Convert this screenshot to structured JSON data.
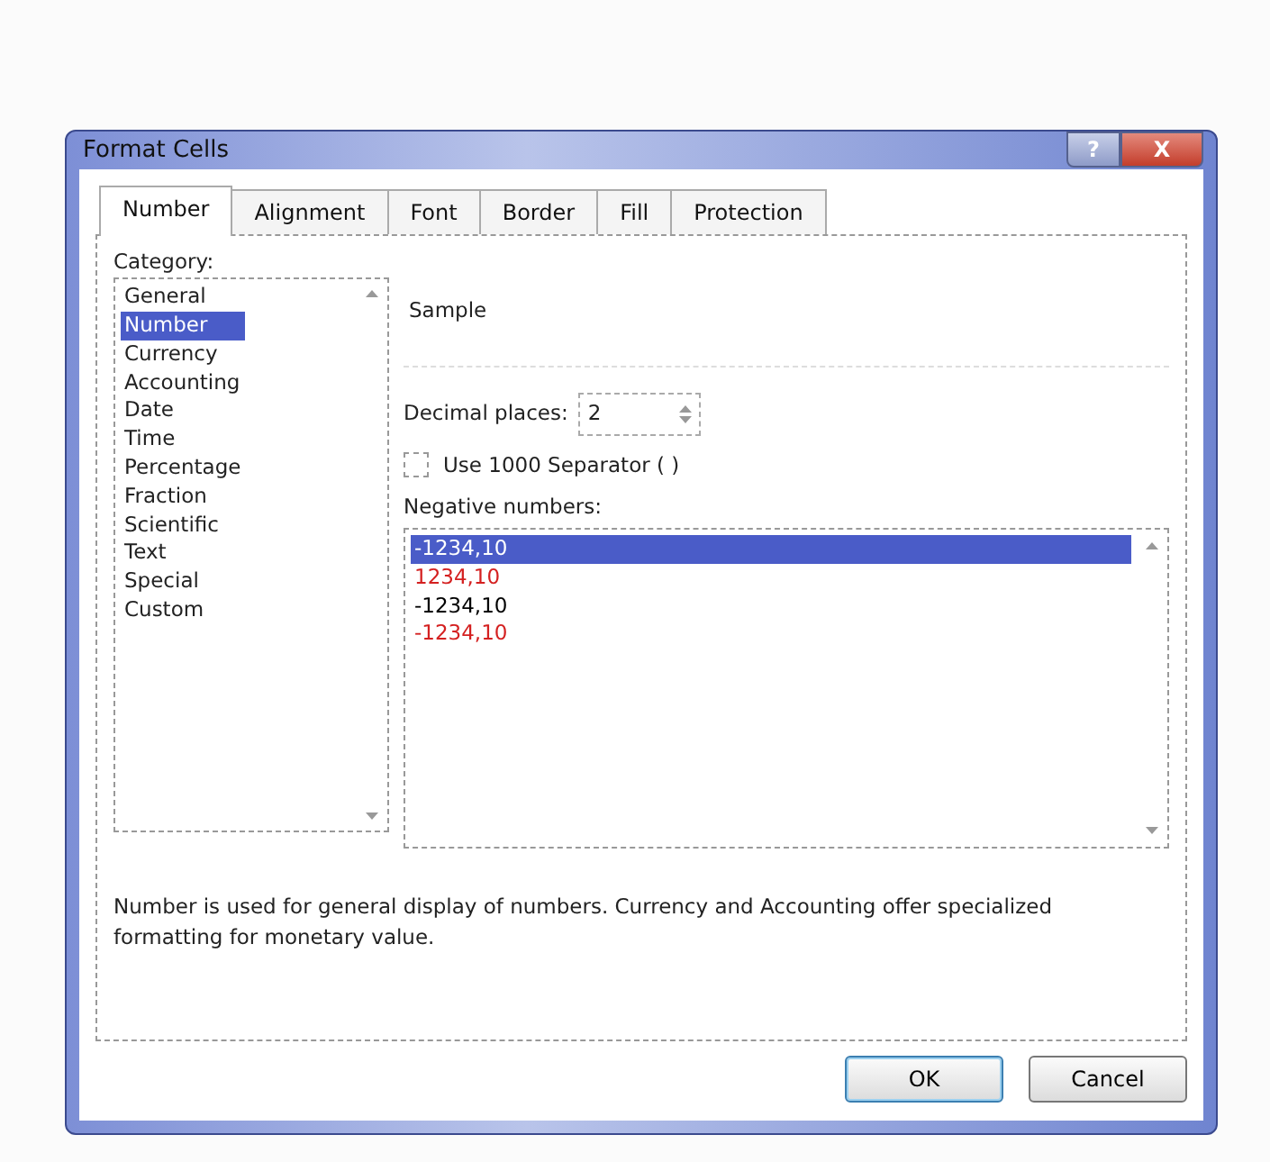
{
  "window": {
    "title": "Format Cells",
    "controls": [
      "?",
      "X"
    ]
  },
  "tabs": [
    {
      "label": "Number",
      "selected": true
    },
    {
      "label": "Alignment",
      "selected": false
    },
    {
      "label": "Font",
      "selected": false
    },
    {
      "label": "Border",
      "selected": false
    },
    {
      "label": "Fill",
      "selected": false
    },
    {
      "label": "Protection",
      "selected": false
    }
  ],
  "category": {
    "label": "Category:",
    "items": [
      {
        "label": "General",
        "selected": false
      },
      {
        "label": "Number",
        "selected": true
      },
      {
        "label": "Currency",
        "selected": false
      },
      {
        "label": "Accounting",
        "selected": false
      },
      {
        "label": "Date",
        "selected": false
      },
      {
        "label": "Time",
        "selected": false
      },
      {
        "label": "Percentage",
        "selected": false
      },
      {
        "label": "Fraction",
        "selected": false
      },
      {
        "label": "Scientific",
        "selected": false
      },
      {
        "label": "Text",
        "selected": false
      },
      {
        "label": "Special",
        "selected": false
      },
      {
        "label": "Custom",
        "selected": false
      }
    ]
  },
  "sample": {
    "label": "Sample"
  },
  "decimal_places": {
    "label": "Decimal places:",
    "value": "2"
  },
  "separator": {
    "label": "Use 1000 Separator ( )",
    "checked": false
  },
  "negative_numbers": {
    "label": "Negative numbers:",
    "items": [
      {
        "label": "-1234,10",
        "selected": true
      },
      {
        "label": "1234,10",
        "selected": false,
        "color": "#d42020"
      },
      {
        "label": "-1234,10",
        "selected": false,
        "color": "#000000"
      },
      {
        "label": "-1234,10",
        "selected": false,
        "color": "#d42020"
      }
    ]
  },
  "description": "Number is used for general display of numbers.  Currency and Accounting offer specialized formatting for monetary value.",
  "buttons": [
    {
      "label": "OK",
      "default": true
    },
    {
      "label": "Cancel",
      "default": false
    }
  ]
}
